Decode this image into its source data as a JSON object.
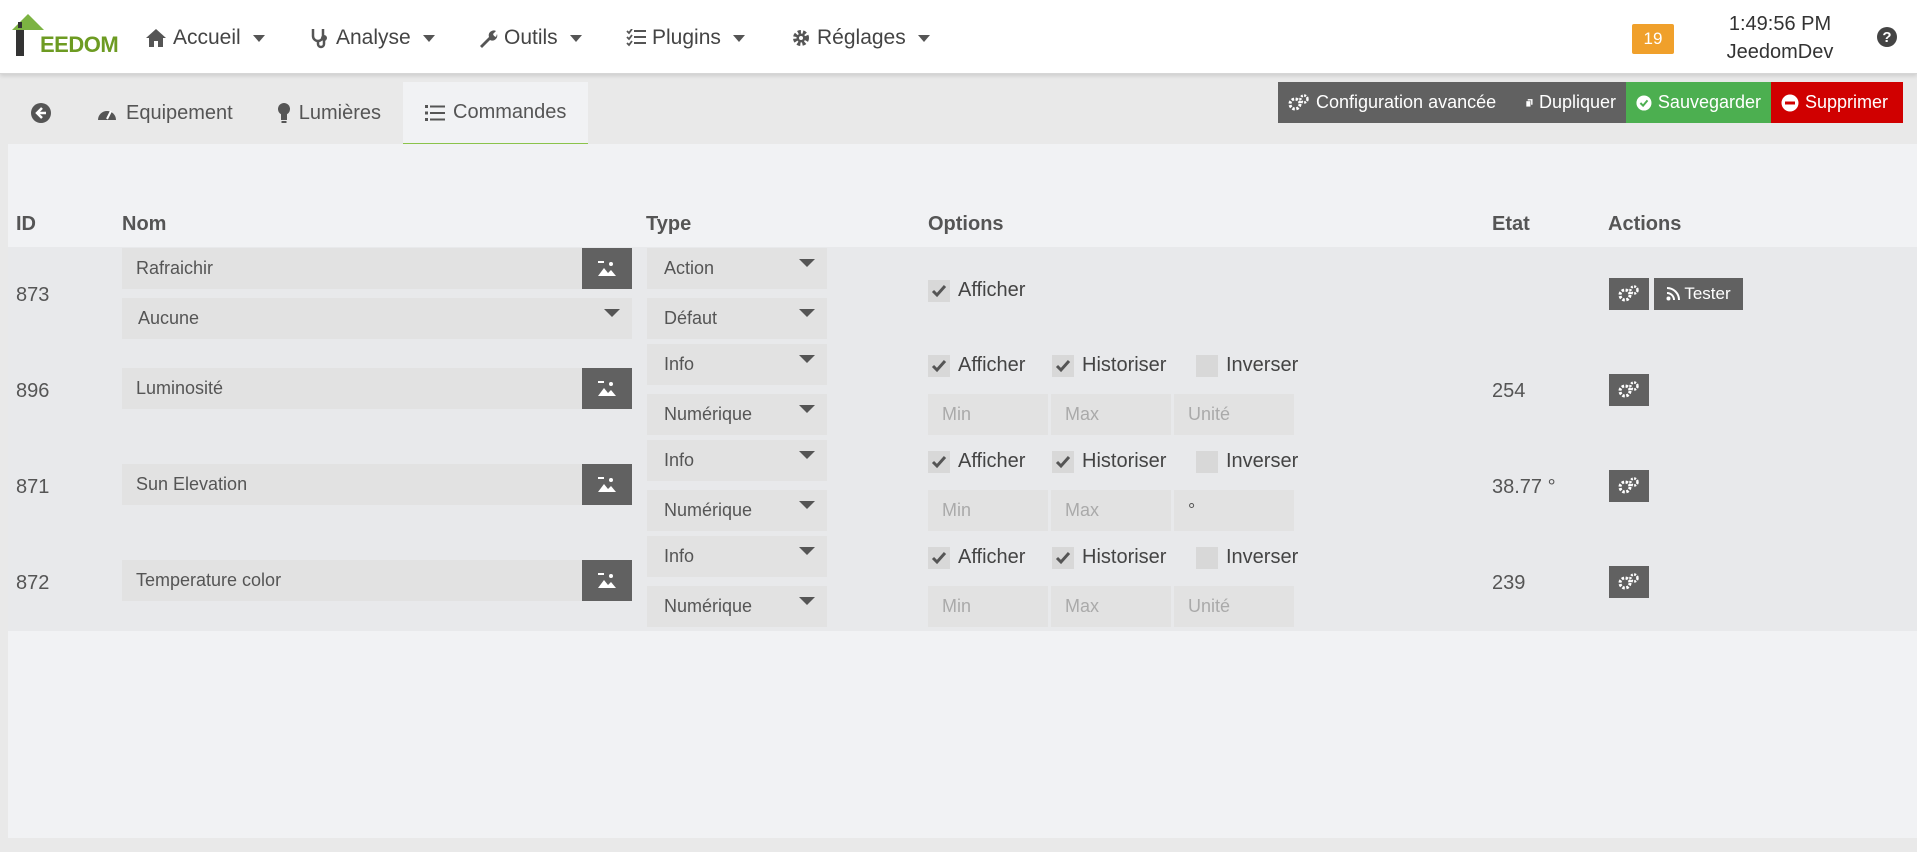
{
  "navbar": {
    "logo_text": "EEDOM",
    "menu": [
      {
        "label": "Accueil",
        "icon": "home-icon"
      },
      {
        "label": "Analyse",
        "icon": "stethoscope-icon"
      },
      {
        "label": "Outils",
        "icon": "wrench-icon"
      },
      {
        "label": "Plugins",
        "icon": "tasks-icon"
      },
      {
        "label": "Réglages",
        "icon": "gear-icon"
      }
    ],
    "notification_count": "19",
    "time": "1:49:56 PM",
    "hostname": "JeedomDev",
    "help_icon": "question-circle-icon"
  },
  "tabs": [
    {
      "label": "",
      "icon": "arrow-circle-left-icon"
    },
    {
      "label": "Equipement",
      "icon": "tachometer-icon"
    },
    {
      "label": "Lumières",
      "icon": "lightbulb-icon"
    },
    {
      "label": "Commandes",
      "icon": "list-icon"
    }
  ],
  "actions": {
    "config": "Configuration avancée",
    "duplicate": "Dupliquer",
    "save": "Sauvegarder",
    "delete": "Supprimer"
  },
  "table": {
    "headers": {
      "id": "ID",
      "nom": "Nom",
      "type": "Type",
      "options": "Options",
      "etat": "Etat",
      "actions": "Actions"
    },
    "rows": [
      {
        "id": "873",
        "name": "Rafraichir",
        "sub_select": "Aucune",
        "type": "Action",
        "subtype": "Défaut",
        "afficher": "Afficher",
        "etat": "",
        "test_label": "Tester"
      },
      {
        "id": "896",
        "name": "Luminosité",
        "type": "Info",
        "subtype": "Numérique",
        "afficher": "Afficher",
        "historiser": "Historiser",
        "inverser": "Inverser",
        "min": "Min",
        "max": "Max",
        "unit": "Unité",
        "etat": "254"
      },
      {
        "id": "871",
        "name": "Sun Elevation",
        "type": "Info",
        "subtype": "Numérique",
        "afficher": "Afficher",
        "historiser": "Historiser",
        "inverser": "Inverser",
        "min": "Min",
        "max": "Max",
        "unit": "°",
        "etat": "38.77 °"
      },
      {
        "id": "872",
        "name": "Temperature color",
        "type": "Info",
        "subtype": "Numérique",
        "afficher": "Afficher",
        "historiser": "Historiser",
        "inverser": "Inverser",
        "min": "Min",
        "max": "Max",
        "unit": "Unité",
        "etat": "239"
      }
    ]
  },
  "colors": {
    "accent_green": "#4caf50",
    "danger_red": "#d00000",
    "badge_orange": "#f0a02b",
    "dark_button": "#616161"
  }
}
